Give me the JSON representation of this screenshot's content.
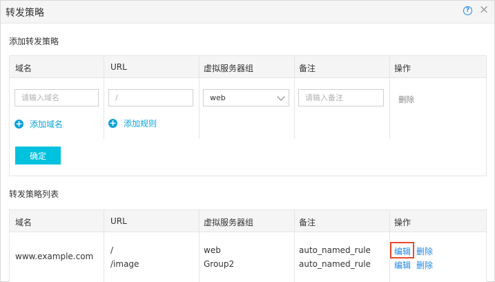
{
  "dialog": {
    "title": "转发策略",
    "help_icon": "question-circle-icon",
    "close_icon": "close-icon"
  },
  "add_section": {
    "label": "添加转发策略",
    "columns": [
      "域名",
      "URL",
      "虚拟服务器组",
      "备注",
      "操作"
    ],
    "domain_placeholder": "请输入域名",
    "url_placeholder": "/",
    "server_group_value": "web",
    "remark_placeholder": "请输入备注",
    "delete_label": "删除",
    "add_domain_label": "添加域名",
    "add_rule_label": "添加规则",
    "confirm_label": "确定"
  },
  "list_section": {
    "label": "转发策略列表",
    "columns": [
      "域名",
      "URL",
      "虚拟服务器组",
      "备注",
      "操作"
    ],
    "rows": [
      {
        "domain": "www.example.com",
        "rules": [
          {
            "url": "/",
            "server_group": "web",
            "remark": "auto_named_rule",
            "edit": "编辑",
            "delete": "删除"
          },
          {
            "url": "/image",
            "server_group": "Group2",
            "remark": "auto_named_rule",
            "edit": "编辑",
            "delete": "删除"
          }
        ]
      }
    ]
  },
  "colors": {
    "accent": "#00c1de",
    "link": "#1e88e5",
    "highlight": "#e8492b"
  }
}
